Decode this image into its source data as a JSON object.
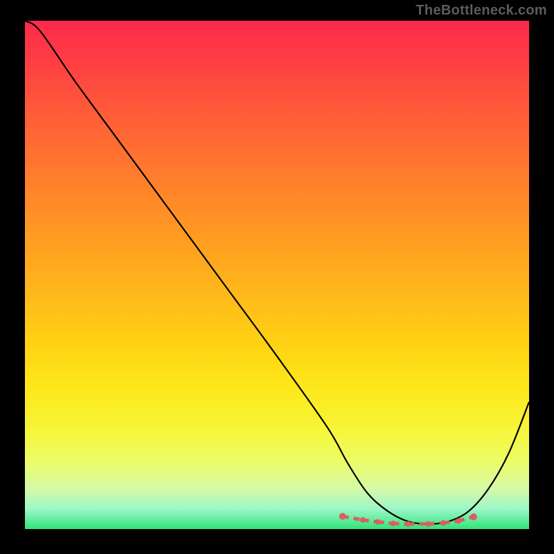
{
  "attribution": "TheBottleneck.com",
  "chart_data": {
    "type": "line",
    "title": "",
    "xlabel": "",
    "ylabel": "",
    "xlim": [
      0,
      100
    ],
    "ylim": [
      0,
      100
    ],
    "series": [
      {
        "name": "curve",
        "x": [
          0,
          3,
          10,
          20,
          30,
          40,
          50,
          60,
          64,
          68,
          72,
          76,
          80,
          84,
          88,
          92,
          96,
          100
        ],
        "values": [
          100,
          98,
          88,
          74.5,
          61,
          47.5,
          34,
          20,
          13,
          7,
          3.5,
          1.5,
          1,
          1.5,
          3.5,
          8,
          15,
          25
        ]
      }
    ],
    "marker_points": {
      "x": [
        63,
        67,
        70,
        73,
        76,
        80,
        83,
        86,
        89
      ],
      "values": [
        2.5,
        1.8,
        1.4,
        1.1,
        1.0,
        1.0,
        1.2,
        1.6,
        2.4
      ]
    },
    "colors": {
      "curve": "#000000",
      "markers": "#d86060",
      "gradient_top": "#fd2a4b",
      "gradient_bottom": "#33e37a"
    }
  }
}
